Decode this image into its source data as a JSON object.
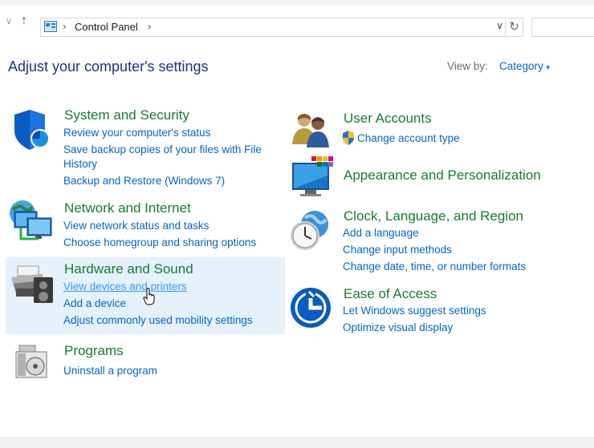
{
  "address": {
    "path": "Control Panel"
  },
  "page": {
    "title": "Adjust your computer's settings",
    "view_by_label": "View by:",
    "view_by_value": "Category"
  },
  "icons": {
    "back": "chevron-down-icon",
    "up": "arrow-up-icon",
    "refresh": "refresh-icon"
  },
  "left": [
    {
      "title": "System and Security",
      "icon": "shield-icon",
      "links": [
        "Review your computer's status",
        "Save backup copies of your files with File",
        "History",
        "Backup and Restore (Windows 7)"
      ]
    },
    {
      "title": "Network and Internet",
      "icon": "network-icon",
      "links": [
        "View network status and tasks",
        "Choose homegroup and sharing options"
      ]
    },
    {
      "title": "Hardware and Sound",
      "icon": "printer-icon",
      "links": [
        "View devices and printers",
        "Add a device",
        "Adjust commonly used mobility settings"
      ]
    },
    {
      "title": "Programs",
      "icon": "programs-icon",
      "links": [
        "Uninstall a program"
      ]
    }
  ],
  "right": [
    {
      "title": "User Accounts",
      "icon": "users-icon",
      "links": [
        "Change account type"
      ]
    },
    {
      "title": "Appearance and Personalization",
      "icon": "monitor-icon",
      "links": []
    },
    {
      "title": "Clock, Language, and Region",
      "icon": "clock-globe-icon",
      "links": [
        "Add a language",
        "Change input methods",
        "Change date, time, or number formats"
      ]
    },
    {
      "title": "Ease of Access",
      "icon": "ease-of-access-icon",
      "links": [
        "Let Windows suggest settings",
        "Optimize visual display"
      ]
    }
  ],
  "colors": {
    "title_green": "#157c32",
    "link_blue": "#0066cc",
    "hover_bg": "#e5f1fb",
    "heading_blue": "#1e3287"
  }
}
